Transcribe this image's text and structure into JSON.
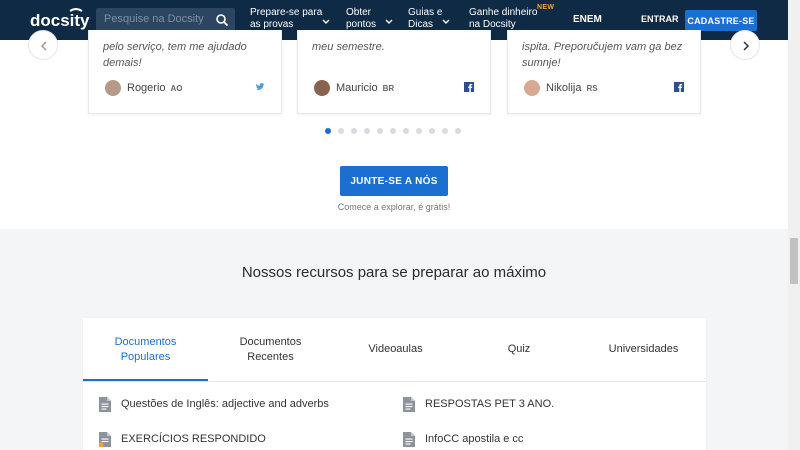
{
  "navbar": {
    "logo_text": "docsity",
    "search_placeholder": "Pesquise na Docsity",
    "items": [
      {
        "label_line1": "Prepare-se para",
        "label_line2": "as provas"
      },
      {
        "label_line1": "Obter",
        "label_line2": "pontos"
      },
      {
        "label_line1": "Guias e",
        "label_line2": "Dicas"
      },
      {
        "label_line1": "Ganhe dinheiro",
        "label_line2": "na Docsity"
      }
    ],
    "new_badge": "NEW",
    "enem": "ENEM",
    "entrar": "ENTRAR",
    "cadastre": "CADASTRE-SE"
  },
  "testimonials": [
    {
      "quote": "pelo serviço, tem me ajudado demais!",
      "name": "Rogerio",
      "country": "AO",
      "social": "twitter-icon"
    },
    {
      "quote": "meu semestre.",
      "name": "Mauricio",
      "country": "BR",
      "social": "facebook-icon"
    },
    {
      "quote": "ispita. Preporučujem vam ga bez sumnje!",
      "name": "Nikolija",
      "country": "RS",
      "social": "facebook-icon"
    }
  ],
  "carousel": {
    "dot_count": 11,
    "active_index": 0
  },
  "join_button": "JUNTE-SE A NÓS",
  "join_subtitle": "Comece a explorar, é grátis!",
  "section": {
    "title": "Nossos recursos para se preparar ao máximo",
    "tabs": [
      {
        "line1": "Documentos",
        "line2": "Populares"
      },
      {
        "line1": "Documentos",
        "line2": "Recentes"
      },
      {
        "line1": "Videoaulas",
        "line2": ""
      },
      {
        "line1": "Quiz",
        "line2": ""
      },
      {
        "line1": "Universidades",
        "line2": ""
      }
    ],
    "active_tab": 0,
    "documents": [
      "Questões de Inglês: adjective and adverbs",
      "RESPOSTAS PET 3 ANO.",
      "EXERCÍCIOS RESPONDIDO",
      "InfoCC apostila e cc"
    ]
  },
  "colors": {
    "navbar": "#0f2a44",
    "accent": "#1a6fd1",
    "new_badge": "#f5a623",
    "section_bg": "#f4f5f7"
  }
}
